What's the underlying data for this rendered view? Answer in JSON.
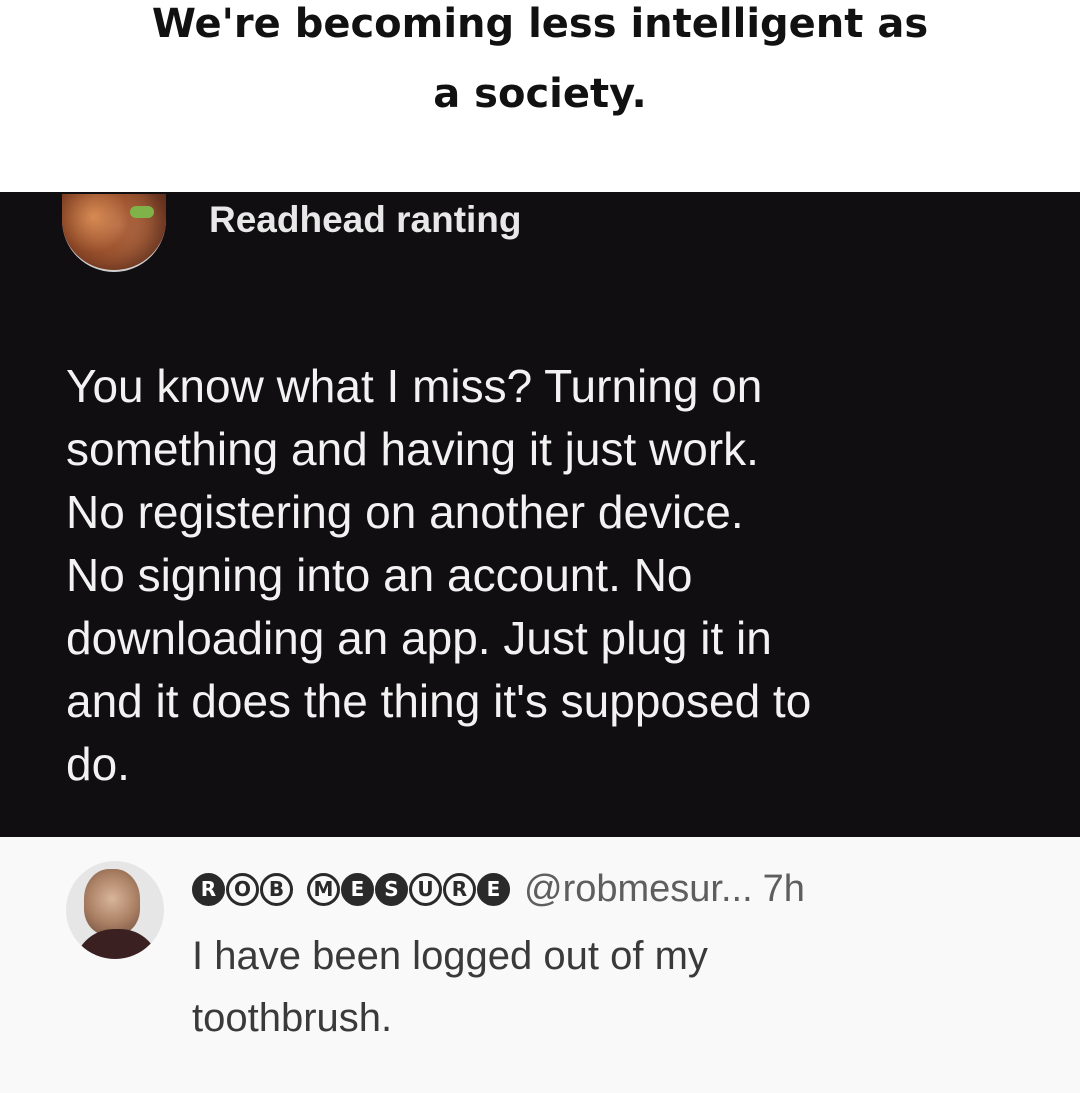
{
  "caption": {
    "line1": "We're becoming less intelligent as",
    "line2": "a society."
  },
  "post": {
    "author": "Readhead ranting",
    "avatar_icon": "profile-photo-icon",
    "lines": [
      "You know what I miss? Turning on",
      "something and having it just work.",
      "No registering on another device.",
      "No signing into an account. No",
      "downloading an app. Just plug it in",
      "and it does the thing it's supposed to",
      "do."
    ]
  },
  "reply": {
    "avatar_icon": "profile-photo-icon",
    "name_glyphs": {
      "word1": [
        "R",
        "O",
        "B"
      ],
      "word2": [
        "M",
        "E",
        "S",
        "U",
        "R",
        "E"
      ]
    },
    "handle": "@robmesur...",
    "time": "7h",
    "lines": [
      "I have been logged out of my",
      "toothbrush."
    ]
  },
  "colors": {
    "post_bg": "#100e10",
    "reply_bg": "#f9f9f9",
    "caption_text": "#111111"
  }
}
